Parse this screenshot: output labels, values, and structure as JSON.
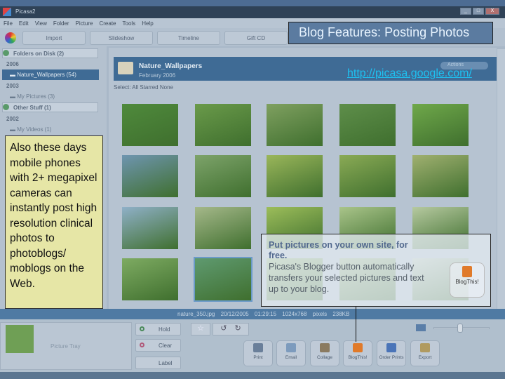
{
  "window": {
    "title": "Picasa2",
    "controls": [
      "_",
      "□",
      "X"
    ]
  },
  "menu": [
    "File",
    "Edit",
    "View",
    "Folder",
    "Picture",
    "Create",
    "Tools",
    "Help"
  ],
  "toolbar": {
    "import": "Import",
    "slideshow": "Slideshow",
    "timeline": "Timeline",
    "giftcd": "Gift CD"
  },
  "sidebar": {
    "sections": [
      {
        "label": "Folders on Disk (2)"
      },
      {
        "label": "Other Stuff (1)"
      }
    ],
    "years": [
      "2006",
      "2003",
      "2002"
    ],
    "folders": [
      {
        "label": "Nature_Wallpapers (54)"
      },
      {
        "label": "My Pictures (3)"
      },
      {
        "label": "My Videos (1)"
      }
    ]
  },
  "album": {
    "name": "Nature_Wallpapers",
    "date": "February 2006",
    "actions": "Actions",
    "select_label": "Select:",
    "select_options": [
      "All",
      "Starred",
      "None"
    ]
  },
  "thumbnails": [
    "#4f8a3c",
    "#6a9a4a",
    "#7fa060",
    "#5e8e4a",
    "#6fa84a",
    "#6e95b0",
    "#7da36a",
    "#9ab65a",
    "#8aaa55",
    "#a0b070",
    "#8fb0c8",
    "#a5b88a",
    "#9cbd5a",
    "#a9c48a",
    "#b6c9a0",
    "#7eab62",
    "#5f9a70",
    "#9fc07a",
    "#a8c08a",
    "#c7d2c0"
  ],
  "overlay": {
    "title": "Blog Features: Posting Photos",
    "url": "http://picasa.google.com/"
  },
  "note": "Also these days mobile phones with 2+ megapixel cameras can instantly post high resolution clinical photos to photoblogs/ moblogs on the Web.",
  "callout": {
    "heading": "Put pictures on your own site, for free.",
    "body": "Picasa's Blogger button automatically transfers your selected pictures and text up to your blog.",
    "badge": "BlogThis!"
  },
  "status": {
    "file": "nature_350.jpg",
    "datetime": "20/12/2005 01:29:15",
    "dimensions": "1024x768 pixels",
    "size": "238KB"
  },
  "tray": {
    "label": "Picture Tray",
    "hold": "Hold",
    "clear": "Clear",
    "label_btn": "Label"
  },
  "actions": [
    {
      "label": "Print",
      "color": "#6a7f9a"
    },
    {
      "label": "Email",
      "color": "#7d9bbd"
    },
    {
      "label": "Collage",
      "color": "#8a7a60"
    },
    {
      "label": "BlogThis!",
      "color": "#e07a2a"
    },
    {
      "label": "Order Prints",
      "color": "#4a74b8"
    },
    {
      "label": "Export",
      "color": "#b09a60"
    }
  ]
}
